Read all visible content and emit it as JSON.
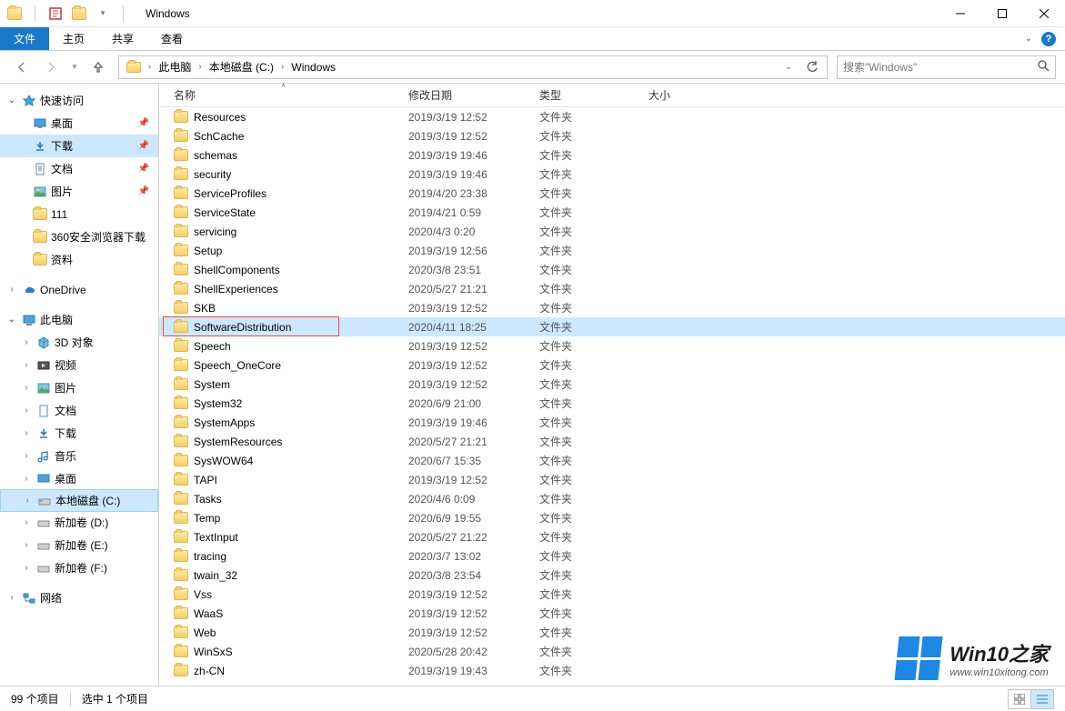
{
  "window": {
    "title": "Windows"
  },
  "ribbon": {
    "file": "文件",
    "home": "主页",
    "share": "共享",
    "view": "查看"
  },
  "breadcrumb": {
    "root": "此电脑",
    "drive": "本地磁盘 (C:)",
    "folder": "Windows"
  },
  "search": {
    "placeholder": "搜索\"Windows\""
  },
  "sidebar": {
    "quick_access": "快速访问",
    "desktop": "桌面",
    "downloads": "下载",
    "documents": "文档",
    "pictures": "图片",
    "folder111": "111",
    "browser_dl": "360安全浏览器下载",
    "materials": "资料",
    "onedrive": "OneDrive",
    "this_pc": "此电脑",
    "objects3d": "3D 对象",
    "videos": "视频",
    "pictures2": "图片",
    "documents2": "文档",
    "downloads2": "下载",
    "music": "音乐",
    "desktop2": "桌面",
    "drive_c": "本地磁盘 (C:)",
    "drive_d": "新加卷 (D:)",
    "drive_e": "新加卷 (E:)",
    "drive_f": "新加卷 (F:)",
    "network": "网络"
  },
  "columns": {
    "name": "名称",
    "date": "修改日期",
    "type": "类型",
    "size": "大小"
  },
  "type_folder": "文件夹",
  "files": [
    {
      "name": "Resources",
      "date": "2019/3/19 12:52"
    },
    {
      "name": "SchCache",
      "date": "2019/3/19 12:52"
    },
    {
      "name": "schemas",
      "date": "2019/3/19 19:46"
    },
    {
      "name": "security",
      "date": "2019/3/19 19:46"
    },
    {
      "name": "ServiceProfiles",
      "date": "2019/4/20 23:38"
    },
    {
      "name": "ServiceState",
      "date": "2019/4/21 0:59"
    },
    {
      "name": "servicing",
      "date": "2020/4/3 0:20"
    },
    {
      "name": "Setup",
      "date": "2019/3/19 12:56"
    },
    {
      "name": "ShellComponents",
      "date": "2020/3/8 23:51"
    },
    {
      "name": "ShellExperiences",
      "date": "2020/5/27 21:21"
    },
    {
      "name": "SKB",
      "date": "2019/3/19 12:52"
    },
    {
      "name": "SoftwareDistribution",
      "date": "2020/4/11 18:25",
      "selected": true
    },
    {
      "name": "Speech",
      "date": "2019/3/19 12:52"
    },
    {
      "name": "Speech_OneCore",
      "date": "2019/3/19 12:52"
    },
    {
      "name": "System",
      "date": "2019/3/19 12:52"
    },
    {
      "name": "System32",
      "date": "2020/6/9 21:00"
    },
    {
      "name": "SystemApps",
      "date": "2019/3/19 19:46"
    },
    {
      "name": "SystemResources",
      "date": "2020/5/27 21:21"
    },
    {
      "name": "SysWOW64",
      "date": "2020/6/7 15:35"
    },
    {
      "name": "TAPI",
      "date": "2019/3/19 12:52"
    },
    {
      "name": "Tasks",
      "date": "2020/4/6 0:09"
    },
    {
      "name": "Temp",
      "date": "2020/6/9 19:55"
    },
    {
      "name": "TextInput",
      "date": "2020/5/27 21:22"
    },
    {
      "name": "tracing",
      "date": "2020/3/7 13:02"
    },
    {
      "name": "twain_32",
      "date": "2020/3/8 23:54"
    },
    {
      "name": "Vss",
      "date": "2019/3/19 12:52"
    },
    {
      "name": "WaaS",
      "date": "2019/3/19 12:52"
    },
    {
      "name": "Web",
      "date": "2019/3/19 12:52"
    },
    {
      "name": "WinSxS",
      "date": "2020/5/28 20:42"
    },
    {
      "name": "zh-CN",
      "date": "2019/3/19 19:43"
    }
  ],
  "status": {
    "total": "99 个项目",
    "selected": "选中 1 个项目"
  },
  "watermark": {
    "title": "Win10之家",
    "url": "www.win10xitong.com"
  }
}
